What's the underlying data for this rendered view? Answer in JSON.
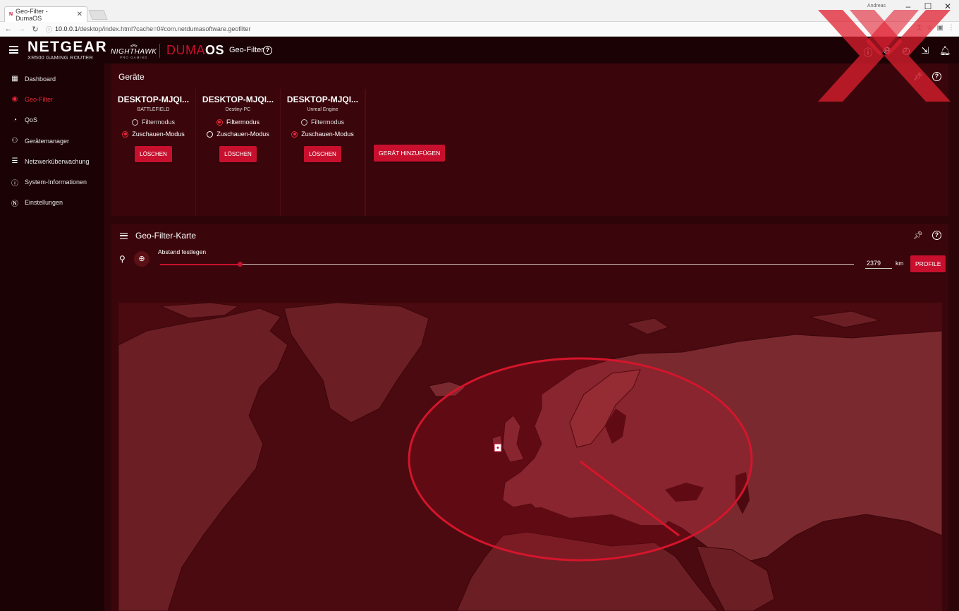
{
  "browser": {
    "tab_title": "Geo-Filter - DumaOS",
    "tab_favicon": "N",
    "user": "Andreas",
    "url_host": "10.0.0.1",
    "url_path": "/desktop/index.html?cache=0#com.netdumasoftware.geofilter"
  },
  "header": {
    "brand": "NETGEAR",
    "brand_sub": "XR500 GAMING ROUTER",
    "nighthawk": "NIGHTHAWK",
    "nighthawk_sub": "PRO GAMING",
    "duma": "DUMA",
    "duma_os": "OS",
    "page_title": "Geo-Filter",
    "icons": [
      "info-icon",
      "globe-icon",
      "history-icon",
      "exit-icon",
      "bell-icon"
    ]
  },
  "sidebar": {
    "items": [
      {
        "label": "Dashboard",
        "icon": "dashboard-icon"
      },
      {
        "label": "Geo-Filter",
        "icon": "geofilter-icon",
        "active": true
      },
      {
        "label": "QoS",
        "icon": "qos-icon"
      },
      {
        "label": "Gerätemanager",
        "icon": "devices-icon"
      },
      {
        "label": "Netzwerküberwachung",
        "icon": "network-monitor-icon"
      },
      {
        "label": "System-Informationen",
        "icon": "system-info-icon"
      },
      {
        "label": "Einstellungen",
        "icon": "settings-icon"
      }
    ]
  },
  "devices_panel": {
    "title": "Geräte",
    "filter_label": "Filtermodus",
    "spectate_label": "Zuschauen-Modus",
    "delete_label": "LÖSCHEN",
    "add_label": "GERÄT HINZUFÜGEN",
    "devices": [
      {
        "name": "DESKTOP-MJQI...",
        "game": "BATTLEFIELD",
        "mode": "spectate"
      },
      {
        "name": "DESKTOP-MJQI...",
        "game": "Destiny-PC",
        "mode": "filter"
      },
      {
        "name": "DESKTOP-MJQI...",
        "game": "Unreal Engine",
        "mode": "spectate"
      }
    ]
  },
  "map_panel": {
    "title": "Geo-Filter-Karte",
    "distance_label": "Abstand festlegen",
    "distance_value": "2379",
    "distance_unit": "km",
    "profile_label": "PROFILE",
    "slider_fraction": 0.115
  },
  "colors": {
    "accent": "#c8102e",
    "background": "#2c0508",
    "panel": "#3b060b",
    "land": "#6b1f24",
    "ocean": "#4a0a0f"
  }
}
